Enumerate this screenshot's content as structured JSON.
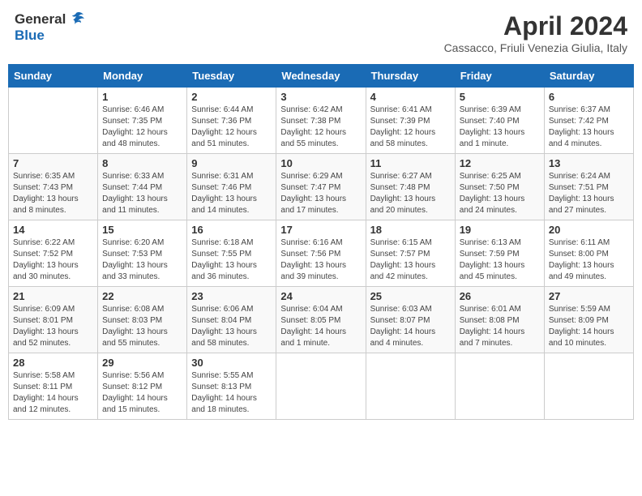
{
  "header": {
    "logo_general": "General",
    "logo_blue": "Blue",
    "title": "April 2024",
    "subtitle": "Cassacco, Friuli Venezia Giulia, Italy"
  },
  "days_of_week": [
    "Sunday",
    "Monday",
    "Tuesday",
    "Wednesday",
    "Thursday",
    "Friday",
    "Saturday"
  ],
  "weeks": [
    [
      {
        "day": "",
        "info": ""
      },
      {
        "day": "1",
        "info": "Sunrise: 6:46 AM\nSunset: 7:35 PM\nDaylight: 12 hours\nand 48 minutes."
      },
      {
        "day": "2",
        "info": "Sunrise: 6:44 AM\nSunset: 7:36 PM\nDaylight: 12 hours\nand 51 minutes."
      },
      {
        "day": "3",
        "info": "Sunrise: 6:42 AM\nSunset: 7:38 PM\nDaylight: 12 hours\nand 55 minutes."
      },
      {
        "day": "4",
        "info": "Sunrise: 6:41 AM\nSunset: 7:39 PM\nDaylight: 12 hours\nand 58 minutes."
      },
      {
        "day": "5",
        "info": "Sunrise: 6:39 AM\nSunset: 7:40 PM\nDaylight: 13 hours\nand 1 minute."
      },
      {
        "day": "6",
        "info": "Sunrise: 6:37 AM\nSunset: 7:42 PM\nDaylight: 13 hours\nand 4 minutes."
      }
    ],
    [
      {
        "day": "7",
        "info": "Sunrise: 6:35 AM\nSunset: 7:43 PM\nDaylight: 13 hours\nand 8 minutes."
      },
      {
        "day": "8",
        "info": "Sunrise: 6:33 AM\nSunset: 7:44 PM\nDaylight: 13 hours\nand 11 minutes."
      },
      {
        "day": "9",
        "info": "Sunrise: 6:31 AM\nSunset: 7:46 PM\nDaylight: 13 hours\nand 14 minutes."
      },
      {
        "day": "10",
        "info": "Sunrise: 6:29 AM\nSunset: 7:47 PM\nDaylight: 13 hours\nand 17 minutes."
      },
      {
        "day": "11",
        "info": "Sunrise: 6:27 AM\nSunset: 7:48 PM\nDaylight: 13 hours\nand 20 minutes."
      },
      {
        "day": "12",
        "info": "Sunrise: 6:25 AM\nSunset: 7:50 PM\nDaylight: 13 hours\nand 24 minutes."
      },
      {
        "day": "13",
        "info": "Sunrise: 6:24 AM\nSunset: 7:51 PM\nDaylight: 13 hours\nand 27 minutes."
      }
    ],
    [
      {
        "day": "14",
        "info": "Sunrise: 6:22 AM\nSunset: 7:52 PM\nDaylight: 13 hours\nand 30 minutes."
      },
      {
        "day": "15",
        "info": "Sunrise: 6:20 AM\nSunset: 7:53 PM\nDaylight: 13 hours\nand 33 minutes."
      },
      {
        "day": "16",
        "info": "Sunrise: 6:18 AM\nSunset: 7:55 PM\nDaylight: 13 hours\nand 36 minutes."
      },
      {
        "day": "17",
        "info": "Sunrise: 6:16 AM\nSunset: 7:56 PM\nDaylight: 13 hours\nand 39 minutes."
      },
      {
        "day": "18",
        "info": "Sunrise: 6:15 AM\nSunset: 7:57 PM\nDaylight: 13 hours\nand 42 minutes."
      },
      {
        "day": "19",
        "info": "Sunrise: 6:13 AM\nSunset: 7:59 PM\nDaylight: 13 hours\nand 45 minutes."
      },
      {
        "day": "20",
        "info": "Sunrise: 6:11 AM\nSunset: 8:00 PM\nDaylight: 13 hours\nand 49 minutes."
      }
    ],
    [
      {
        "day": "21",
        "info": "Sunrise: 6:09 AM\nSunset: 8:01 PM\nDaylight: 13 hours\nand 52 minutes."
      },
      {
        "day": "22",
        "info": "Sunrise: 6:08 AM\nSunset: 8:03 PM\nDaylight: 13 hours\nand 55 minutes."
      },
      {
        "day": "23",
        "info": "Sunrise: 6:06 AM\nSunset: 8:04 PM\nDaylight: 13 hours\nand 58 minutes."
      },
      {
        "day": "24",
        "info": "Sunrise: 6:04 AM\nSunset: 8:05 PM\nDaylight: 14 hours\nand 1 minute."
      },
      {
        "day": "25",
        "info": "Sunrise: 6:03 AM\nSunset: 8:07 PM\nDaylight: 14 hours\nand 4 minutes."
      },
      {
        "day": "26",
        "info": "Sunrise: 6:01 AM\nSunset: 8:08 PM\nDaylight: 14 hours\nand 7 minutes."
      },
      {
        "day": "27",
        "info": "Sunrise: 5:59 AM\nSunset: 8:09 PM\nDaylight: 14 hours\nand 10 minutes."
      }
    ],
    [
      {
        "day": "28",
        "info": "Sunrise: 5:58 AM\nSunset: 8:11 PM\nDaylight: 14 hours\nand 12 minutes."
      },
      {
        "day": "29",
        "info": "Sunrise: 5:56 AM\nSunset: 8:12 PM\nDaylight: 14 hours\nand 15 minutes."
      },
      {
        "day": "30",
        "info": "Sunrise: 5:55 AM\nSunset: 8:13 PM\nDaylight: 14 hours\nand 18 minutes."
      },
      {
        "day": "",
        "info": ""
      },
      {
        "day": "",
        "info": ""
      },
      {
        "day": "",
        "info": ""
      },
      {
        "day": "",
        "info": ""
      }
    ]
  ]
}
